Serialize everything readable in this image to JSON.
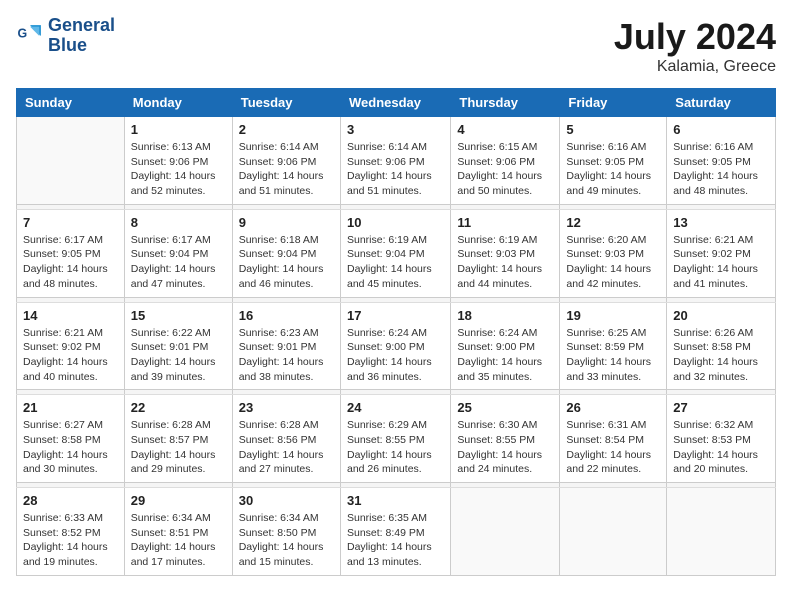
{
  "header": {
    "logo_line1": "General",
    "logo_line2": "Blue",
    "month_year": "July 2024",
    "location": "Kalamia, Greece"
  },
  "weekdays": [
    "Sunday",
    "Monday",
    "Tuesday",
    "Wednesday",
    "Thursday",
    "Friday",
    "Saturday"
  ],
  "weeks": [
    [
      {
        "day": "",
        "sunrise": "",
        "sunset": "",
        "daylight": ""
      },
      {
        "day": "1",
        "sunrise": "Sunrise: 6:13 AM",
        "sunset": "Sunset: 9:06 PM",
        "daylight": "Daylight: 14 hours and 52 minutes."
      },
      {
        "day": "2",
        "sunrise": "Sunrise: 6:14 AM",
        "sunset": "Sunset: 9:06 PM",
        "daylight": "Daylight: 14 hours and 51 minutes."
      },
      {
        "day": "3",
        "sunrise": "Sunrise: 6:14 AM",
        "sunset": "Sunset: 9:06 PM",
        "daylight": "Daylight: 14 hours and 51 minutes."
      },
      {
        "day": "4",
        "sunrise": "Sunrise: 6:15 AM",
        "sunset": "Sunset: 9:06 PM",
        "daylight": "Daylight: 14 hours and 50 minutes."
      },
      {
        "day": "5",
        "sunrise": "Sunrise: 6:16 AM",
        "sunset": "Sunset: 9:05 PM",
        "daylight": "Daylight: 14 hours and 49 minutes."
      },
      {
        "day": "6",
        "sunrise": "Sunrise: 6:16 AM",
        "sunset": "Sunset: 9:05 PM",
        "daylight": "Daylight: 14 hours and 48 minutes."
      }
    ],
    [
      {
        "day": "7",
        "sunrise": "Sunrise: 6:17 AM",
        "sunset": "Sunset: 9:05 PM",
        "daylight": "Daylight: 14 hours and 48 minutes."
      },
      {
        "day": "8",
        "sunrise": "Sunrise: 6:17 AM",
        "sunset": "Sunset: 9:04 PM",
        "daylight": "Daylight: 14 hours and 47 minutes."
      },
      {
        "day": "9",
        "sunrise": "Sunrise: 6:18 AM",
        "sunset": "Sunset: 9:04 PM",
        "daylight": "Daylight: 14 hours and 46 minutes."
      },
      {
        "day": "10",
        "sunrise": "Sunrise: 6:19 AM",
        "sunset": "Sunset: 9:04 PM",
        "daylight": "Daylight: 14 hours and 45 minutes."
      },
      {
        "day": "11",
        "sunrise": "Sunrise: 6:19 AM",
        "sunset": "Sunset: 9:03 PM",
        "daylight": "Daylight: 14 hours and 44 minutes."
      },
      {
        "day": "12",
        "sunrise": "Sunrise: 6:20 AM",
        "sunset": "Sunset: 9:03 PM",
        "daylight": "Daylight: 14 hours and 42 minutes."
      },
      {
        "day": "13",
        "sunrise": "Sunrise: 6:21 AM",
        "sunset": "Sunset: 9:02 PM",
        "daylight": "Daylight: 14 hours and 41 minutes."
      }
    ],
    [
      {
        "day": "14",
        "sunrise": "Sunrise: 6:21 AM",
        "sunset": "Sunset: 9:02 PM",
        "daylight": "Daylight: 14 hours and 40 minutes."
      },
      {
        "day": "15",
        "sunrise": "Sunrise: 6:22 AM",
        "sunset": "Sunset: 9:01 PM",
        "daylight": "Daylight: 14 hours and 39 minutes."
      },
      {
        "day": "16",
        "sunrise": "Sunrise: 6:23 AM",
        "sunset": "Sunset: 9:01 PM",
        "daylight": "Daylight: 14 hours and 38 minutes."
      },
      {
        "day": "17",
        "sunrise": "Sunrise: 6:24 AM",
        "sunset": "Sunset: 9:00 PM",
        "daylight": "Daylight: 14 hours and 36 minutes."
      },
      {
        "day": "18",
        "sunrise": "Sunrise: 6:24 AM",
        "sunset": "Sunset: 9:00 PM",
        "daylight": "Daylight: 14 hours and 35 minutes."
      },
      {
        "day": "19",
        "sunrise": "Sunrise: 6:25 AM",
        "sunset": "Sunset: 8:59 PM",
        "daylight": "Daylight: 14 hours and 33 minutes."
      },
      {
        "day": "20",
        "sunrise": "Sunrise: 6:26 AM",
        "sunset": "Sunset: 8:58 PM",
        "daylight": "Daylight: 14 hours and 32 minutes."
      }
    ],
    [
      {
        "day": "21",
        "sunrise": "Sunrise: 6:27 AM",
        "sunset": "Sunset: 8:58 PM",
        "daylight": "Daylight: 14 hours and 30 minutes."
      },
      {
        "day": "22",
        "sunrise": "Sunrise: 6:28 AM",
        "sunset": "Sunset: 8:57 PM",
        "daylight": "Daylight: 14 hours and 29 minutes."
      },
      {
        "day": "23",
        "sunrise": "Sunrise: 6:28 AM",
        "sunset": "Sunset: 8:56 PM",
        "daylight": "Daylight: 14 hours and 27 minutes."
      },
      {
        "day": "24",
        "sunrise": "Sunrise: 6:29 AM",
        "sunset": "Sunset: 8:55 PM",
        "daylight": "Daylight: 14 hours and 26 minutes."
      },
      {
        "day": "25",
        "sunrise": "Sunrise: 6:30 AM",
        "sunset": "Sunset: 8:55 PM",
        "daylight": "Daylight: 14 hours and 24 minutes."
      },
      {
        "day": "26",
        "sunrise": "Sunrise: 6:31 AM",
        "sunset": "Sunset: 8:54 PM",
        "daylight": "Daylight: 14 hours and 22 minutes."
      },
      {
        "day": "27",
        "sunrise": "Sunrise: 6:32 AM",
        "sunset": "Sunset: 8:53 PM",
        "daylight": "Daylight: 14 hours and 20 minutes."
      }
    ],
    [
      {
        "day": "28",
        "sunrise": "Sunrise: 6:33 AM",
        "sunset": "Sunset: 8:52 PM",
        "daylight": "Daylight: 14 hours and 19 minutes."
      },
      {
        "day": "29",
        "sunrise": "Sunrise: 6:34 AM",
        "sunset": "Sunset: 8:51 PM",
        "daylight": "Daylight: 14 hours and 17 minutes."
      },
      {
        "day": "30",
        "sunrise": "Sunrise: 6:34 AM",
        "sunset": "Sunset: 8:50 PM",
        "daylight": "Daylight: 14 hours and 15 minutes."
      },
      {
        "day": "31",
        "sunrise": "Sunrise: 6:35 AM",
        "sunset": "Sunset: 8:49 PM",
        "daylight": "Daylight: 14 hours and 13 minutes."
      },
      {
        "day": "",
        "sunrise": "",
        "sunset": "",
        "daylight": ""
      },
      {
        "day": "",
        "sunrise": "",
        "sunset": "",
        "daylight": ""
      },
      {
        "day": "",
        "sunrise": "",
        "sunset": "",
        "daylight": ""
      }
    ]
  ]
}
